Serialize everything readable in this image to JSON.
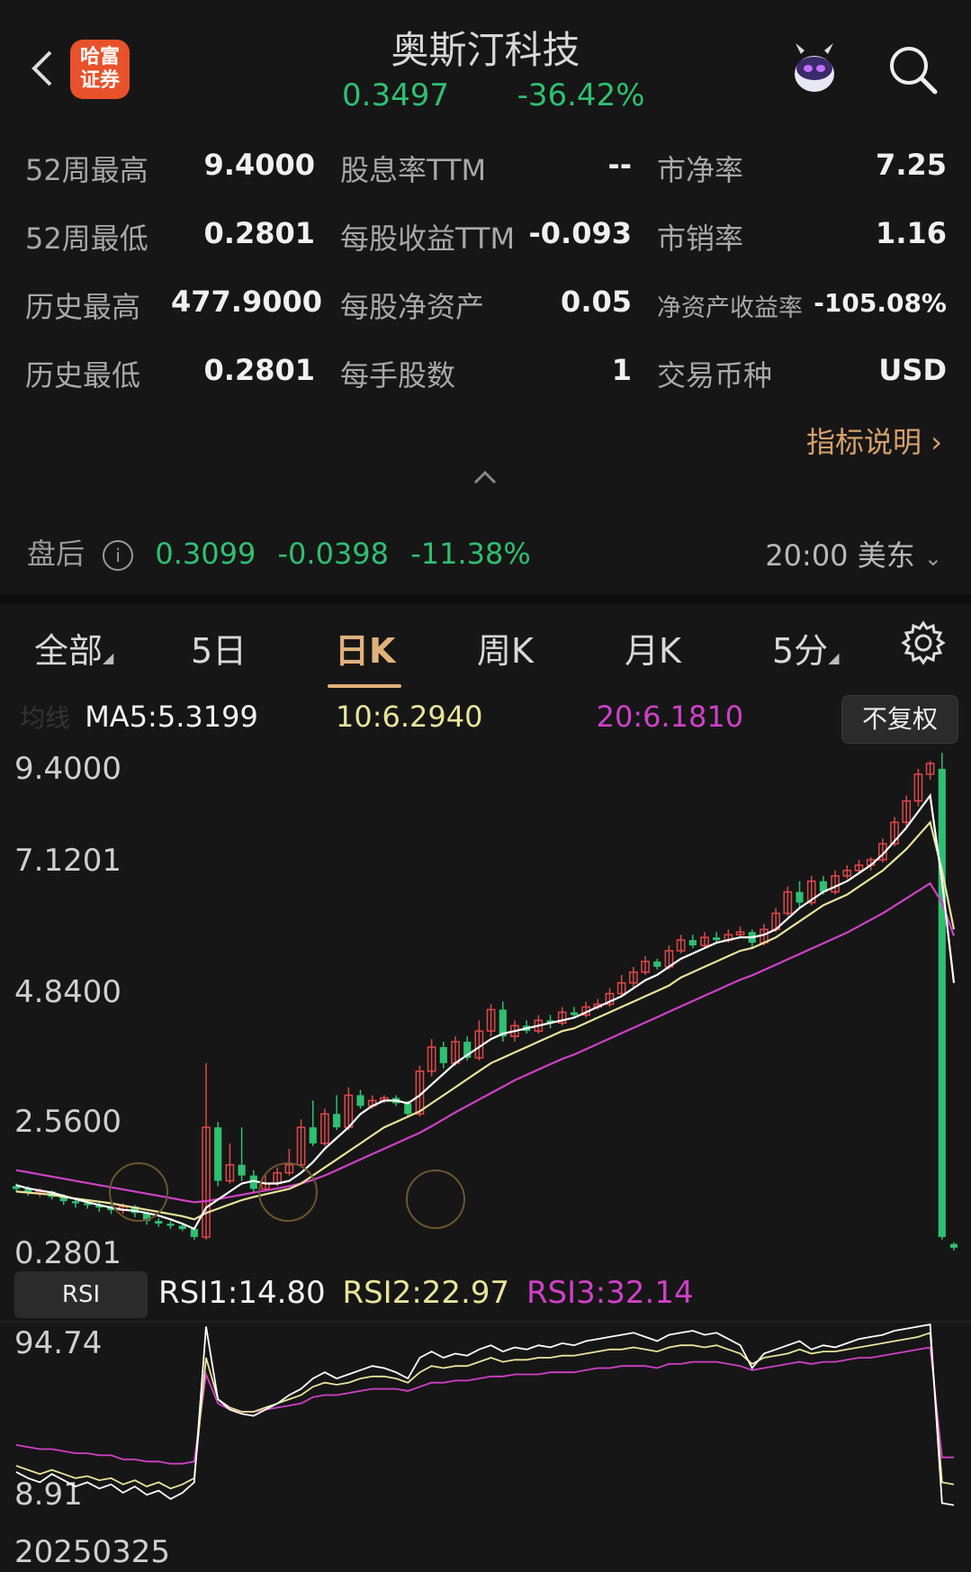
{
  "header": {
    "back_icon": "chevron-left-icon",
    "logo_line1": "哈富",
    "logo_line2": "证券",
    "title": "奥斯汀科技",
    "price": "0.3497",
    "change_pct": "-36.42%",
    "avatar_icon": "robot-avatar-icon",
    "search_icon": "search-icon"
  },
  "stats": [
    {
      "label": "52周最高",
      "value": "9.4000"
    },
    {
      "label": "52周最低",
      "value": "0.2801"
    },
    {
      "label": "历史最高",
      "value": "477.9000"
    },
    {
      "label": "历史最低",
      "value": "0.2801"
    },
    {
      "label": "股息率TTM",
      "value": "--"
    },
    {
      "label": "每股收益TTM",
      "value": "-0.093"
    },
    {
      "label": "每股净资产",
      "value": "0.05"
    },
    {
      "label": "每手股数",
      "value": "1"
    },
    {
      "label": "市净率",
      "value": "7.25"
    },
    {
      "label": "市销率",
      "value": "1.16"
    },
    {
      "label": "净资产收益率",
      "value": "-105.08%"
    },
    {
      "label": "交易币种",
      "value": "USD"
    }
  ],
  "help_link": "指标说明",
  "after_hours": {
    "label": "盘后",
    "price": "0.3099",
    "change": "-0.0398",
    "change_pct": "-11.38%",
    "time": "20:00 美东"
  },
  "tabs": [
    "全部",
    "5日",
    "日K",
    "周K",
    "月K",
    "5分"
  ],
  "active_tab": "日K",
  "ma": {
    "label": "均线",
    "ma5": "MA5:5.3199",
    "ma10": "10:6.2940",
    "ma20": "20:6.1810",
    "adjust_button": "不复权"
  },
  "colors": {
    "up": "#e04848",
    "down": "#2fbf71",
    "ma5": "#ffffff",
    "ma10": "#e8e49a",
    "ma20": "#d040c8",
    "accent": "#e0b27a"
  },
  "chart_data": [
    {
      "type": "candlestick",
      "y_ticks": [
        "9.4000",
        "7.1201",
        "4.8400",
        "2.5600",
        "0.2801"
      ],
      "ylim": [
        0.2801,
        9.4
      ],
      "candles": [
        [
          1.5,
          1.45,
          1.55,
          1.4
        ],
        [
          1.45,
          1.38,
          1.5,
          1.32
        ],
        [
          1.38,
          1.4,
          1.46,
          1.3
        ],
        [
          1.4,
          1.3,
          1.42,
          1.25
        ],
        [
          1.3,
          1.22,
          1.35,
          1.15
        ],
        [
          1.22,
          1.18,
          1.28,
          1.1
        ],
        [
          1.18,
          1.15,
          1.24,
          1.08
        ],
        [
          1.15,
          1.1,
          1.2,
          1.02
        ],
        [
          1.1,
          1.05,
          1.14,
          0.98
        ],
        [
          1.05,
          1.12,
          1.18,
          0.98
        ],
        [
          1.12,
          1.0,
          1.15,
          0.92
        ],
        [
          1.0,
          0.85,
          1.02,
          0.78
        ],
        [
          0.85,
          0.8,
          0.9,
          0.74
        ],
        [
          0.8,
          0.76,
          0.85,
          0.7
        ],
        [
          0.76,
          0.7,
          0.8,
          0.66
        ],
        [
          0.7,
          0.55,
          0.74,
          0.5
        ],
        [
          0.55,
          2.6,
          3.8,
          0.5
        ],
        [
          2.6,
          1.6,
          2.7,
          1.5
        ],
        [
          1.6,
          1.9,
          2.3,
          1.55
        ],
        [
          1.9,
          1.7,
          2.6,
          1.6
        ],
        [
          1.7,
          1.45,
          1.8,
          1.4
        ],
        [
          1.45,
          1.55,
          1.7,
          1.4
        ],
        [
          1.55,
          1.75,
          1.85,
          1.5
        ],
        [
          1.75,
          1.9,
          2.2,
          1.7
        ],
        [
          1.9,
          2.6,
          2.75,
          1.85
        ],
        [
          2.6,
          2.3,
          3.1,
          2.25
        ],
        [
          2.3,
          2.85,
          2.95,
          2.25
        ],
        [
          2.85,
          2.6,
          3.2,
          2.55
        ],
        [
          2.6,
          3.2,
          3.35,
          2.55
        ],
        [
          3.2,
          3.0,
          3.3,
          2.95
        ],
        [
          3.0,
          3.1,
          3.2,
          2.95
        ],
        [
          3.1,
          3.15,
          3.2,
          3.05
        ],
        [
          3.15,
          3.05,
          3.2,
          3.0
        ],
        [
          3.05,
          2.85,
          3.1,
          2.8
        ],
        [
          2.85,
          3.65,
          3.75,
          2.8
        ],
        [
          3.65,
          4.1,
          4.25,
          3.55
        ],
        [
          4.1,
          3.8,
          4.2,
          3.7
        ],
        [
          3.8,
          4.2,
          4.3,
          3.75
        ],
        [
          4.2,
          3.9,
          4.3,
          3.85
        ],
        [
          3.9,
          4.4,
          4.6,
          3.85
        ],
        [
          4.4,
          4.8,
          4.9,
          4.3
        ],
        [
          4.8,
          4.3,
          4.95,
          4.2
        ],
        [
          4.3,
          4.5,
          4.6,
          4.2
        ],
        [
          4.5,
          4.4,
          4.6,
          4.35
        ],
        [
          4.4,
          4.6,
          4.7,
          4.35
        ],
        [
          4.6,
          4.55,
          4.7,
          4.45
        ],
        [
          4.55,
          4.75,
          4.85,
          4.5
        ],
        [
          4.75,
          4.7,
          4.85,
          4.65
        ],
        [
          4.7,
          4.85,
          4.95,
          4.65
        ],
        [
          4.85,
          4.9,
          5.0,
          4.8
        ],
        [
          4.9,
          5.1,
          5.2,
          4.85
        ],
        [
          5.1,
          5.3,
          5.45,
          5.05
        ],
        [
          5.3,
          5.5,
          5.6,
          5.2
        ],
        [
          5.5,
          5.7,
          5.8,
          5.45
        ],
        [
          5.7,
          5.6,
          5.75,
          5.55
        ],
        [
          5.6,
          5.9,
          6.0,
          5.55
        ],
        [
          5.9,
          6.1,
          6.2,
          5.85
        ],
        [
          6.1,
          6.0,
          6.2,
          5.95
        ],
        [
          6.0,
          6.15,
          6.25,
          5.95
        ],
        [
          6.15,
          6.1,
          6.25,
          6.05
        ],
        [
          6.1,
          6.2,
          6.3,
          6.05
        ],
        [
          6.2,
          6.25,
          6.35,
          6.15
        ],
        [
          6.25,
          6.05,
          6.3,
          5.95
        ],
        [
          6.05,
          6.3,
          6.4,
          6.0
        ],
        [
          6.3,
          6.6,
          6.7,
          6.25
        ],
        [
          6.6,
          7.0,
          7.1,
          6.55
        ],
        [
          7.0,
          6.8,
          7.2,
          6.7
        ],
        [
          6.8,
          7.2,
          7.3,
          6.75
        ],
        [
          7.2,
          7.0,
          7.3,
          6.95
        ],
        [
          7.0,
          7.3,
          7.4,
          6.95
        ],
        [
          7.3,
          7.4,
          7.5,
          7.25
        ],
        [
          7.4,
          7.5,
          7.6,
          7.35
        ],
        [
          7.5,
          7.6,
          7.65,
          7.4
        ],
        [
          7.6,
          7.9,
          8.0,
          7.55
        ],
        [
          7.9,
          8.3,
          8.4,
          7.85
        ],
        [
          8.3,
          8.7,
          8.8,
          8.2
        ],
        [
          8.7,
          9.2,
          9.3,
          8.6
        ],
        [
          9.2,
          9.4,
          9.45,
          9.1
        ],
        [
          9.3,
          0.55,
          9.6,
          0.5
        ],
        [
          0.42,
          0.35,
          0.45,
          0.3
        ]
      ],
      "ma5": [
        1.52,
        1.46,
        1.42,
        1.38,
        1.32,
        1.26,
        1.2,
        1.15,
        1.1,
        1.06,
        1.04,
        1.0,
        0.95,
        0.88,
        0.8,
        0.7,
        1.1,
        1.25,
        1.4,
        1.55,
        1.6,
        1.55,
        1.55,
        1.6,
        1.75,
        1.95,
        2.2,
        2.4,
        2.6,
        2.85,
        3.0,
        3.1,
        3.1,
        3.05,
        3.2,
        3.4,
        3.6,
        3.8,
        3.95,
        4.1,
        4.25,
        4.35,
        4.4,
        4.45,
        4.5,
        4.55,
        4.6,
        4.65,
        4.75,
        4.85,
        4.95,
        5.05,
        5.2,
        5.35,
        5.45,
        5.6,
        5.75,
        5.85,
        5.95,
        6.05,
        6.1,
        6.15,
        6.15,
        6.2,
        6.3,
        6.5,
        6.7,
        6.85,
        7.0,
        7.1,
        7.2,
        7.35,
        7.5,
        7.7,
        7.95,
        8.2,
        8.5,
        8.8,
        7.2,
        5.3
      ],
      "ma10": [
        1.4,
        1.38,
        1.36,
        1.34,
        1.3,
        1.27,
        1.24,
        1.21,
        1.18,
        1.14,
        1.1,
        1.06,
        1.02,
        0.98,
        0.94,
        0.88,
        1.0,
        1.08,
        1.16,
        1.24,
        1.3,
        1.35,
        1.4,
        1.45,
        1.55,
        1.7,
        1.85,
        2.0,
        2.15,
        2.3,
        2.45,
        2.6,
        2.7,
        2.8,
        2.9,
        3.05,
        3.2,
        3.35,
        3.5,
        3.65,
        3.8,
        3.9,
        4.0,
        4.1,
        4.2,
        4.3,
        4.4,
        4.45,
        4.55,
        4.65,
        4.75,
        4.85,
        4.95,
        5.05,
        5.15,
        5.25,
        5.4,
        5.5,
        5.6,
        5.7,
        5.8,
        5.9,
        5.95,
        6.05,
        6.15,
        6.3,
        6.45,
        6.6,
        6.75,
        6.85,
        6.95,
        7.1,
        7.25,
        7.4,
        7.6,
        7.8,
        8.05,
        8.3,
        7.4,
        6.3
      ],
      "ma20": [
        1.8,
        1.76,
        1.72,
        1.68,
        1.64,
        1.6,
        1.56,
        1.52,
        1.48,
        1.44,
        1.4,
        1.36,
        1.32,
        1.28,
        1.24,
        1.2,
        1.22,
        1.26,
        1.3,
        1.34,
        1.38,
        1.42,
        1.46,
        1.5,
        1.55,
        1.62,
        1.7,
        1.8,
        1.9,
        2.0,
        2.1,
        2.2,
        2.3,
        2.4,
        2.5,
        2.62,
        2.75,
        2.88,
        3.0,
        3.12,
        3.24,
        3.36,
        3.48,
        3.58,
        3.68,
        3.78,
        3.88,
        3.96,
        4.06,
        4.16,
        4.26,
        4.36,
        4.46,
        4.56,
        4.66,
        4.76,
        4.86,
        4.96,
        5.06,
        5.16,
        5.26,
        5.36,
        5.44,
        5.54,
        5.64,
        5.74,
        5.84,
        5.94,
        6.04,
        6.14,
        6.24,
        6.36,
        6.48,
        6.6,
        6.74,
        6.88,
        7.02,
        7.16,
        6.8,
        6.18
      ]
    },
    {
      "type": "line",
      "title": "RSI",
      "series": [
        {
          "name": "RSI1",
          "last_label": "RSI1:14.80"
        },
        {
          "name": "RSI2",
          "last_label": "RSI2:22.97"
        },
        {
          "name": "RSI3",
          "last_label": "RSI3:32.14"
        }
      ],
      "y_ticks": [
        "94.74",
        "8.91"
      ],
      "ylim": [
        8.91,
        94.74
      ],
      "rsi1": [
        25,
        22,
        20,
        24,
        21,
        18,
        20,
        17,
        19,
        15,
        18,
        14,
        16,
        12,
        15,
        20,
        95,
        60,
        55,
        53,
        52,
        55,
        58,
        62,
        65,
        70,
        73,
        70,
        72,
        74,
        76,
        75,
        73,
        70,
        80,
        83,
        80,
        82,
        81,
        84,
        86,
        83,
        85,
        84,
        86,
        85,
        87,
        86,
        88,
        89,
        90,
        91,
        92,
        90,
        88,
        91,
        92,
        93,
        91,
        92,
        89,
        86,
        75,
        82,
        84,
        86,
        88,
        84,
        86,
        85,
        87,
        89,
        90,
        91,
        93,
        94,
        95,
        96,
        10,
        9
      ],
      "rsi2": [
        28,
        26,
        24,
        26,
        24,
        22,
        23,
        21,
        22,
        19,
        21,
        18,
        20,
        17,
        19,
        22,
        80,
        60,
        56,
        54,
        54,
        56,
        58,
        60,
        62,
        66,
        68,
        67,
        68,
        70,
        71,
        71,
        70,
        68,
        73,
        76,
        75,
        76,
        76,
        78,
        80,
        78,
        79,
        79,
        80,
        80,
        81,
        81,
        82,
        83,
        84,
        84,
        85,
        84,
        83,
        85,
        86,
        86,
        85,
        86,
        84,
        82,
        77,
        80,
        81,
        82,
        84,
        82,
        83,
        83,
        84,
        85,
        86,
        87,
        88,
        89,
        90,
        92,
        20,
        19
      ],
      "rsi3": [
        38,
        37,
        36,
        36,
        35,
        34,
        34,
        33,
        33,
        31,
        31,
        30,
        30,
        29,
        29,
        30,
        72,
        58,
        55,
        54,
        54,
        55,
        56,
        57,
        58,
        61,
        62,
        62,
        63,
        64,
        65,
        65,
        65,
        64,
        66,
        68,
        68,
        69,
        69,
        70,
        71,
        71,
        72,
        72,
        72,
        73,
        73,
        73,
        74,
        75,
        75,
        76,
        76,
        76,
        75,
        77,
        77,
        78,
        78,
        78,
        77,
        76,
        74,
        75,
        76,
        77,
        78,
        77,
        78,
        78,
        79,
        80,
        80,
        81,
        82,
        83,
        84,
        85,
        32,
        32
      ]
    }
  ],
  "rsi_button": "RSI",
  "date_label": "20250325"
}
